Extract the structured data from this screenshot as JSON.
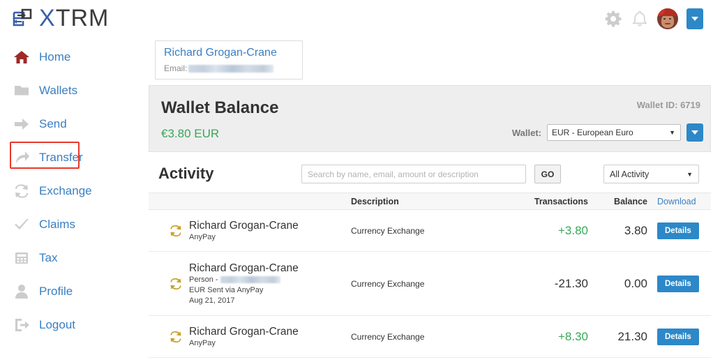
{
  "brand": {
    "name_x": "X",
    "name_rest": "TRM",
    "logo_icon": "exchange-logo-icon"
  },
  "header": {
    "gear_icon": "gear-icon",
    "bell_icon": "bell-icon",
    "avatar_icon": "user-avatar",
    "caret_icon": "chevron-down-icon"
  },
  "sidebar": {
    "items": [
      {
        "label": "Home",
        "icon": "home-icon",
        "active": false
      },
      {
        "label": "Wallets",
        "icon": "folder-icon",
        "active": false
      },
      {
        "label": "Send",
        "icon": "arrow-right-icon",
        "active": false
      },
      {
        "label": "Transfer",
        "icon": "arrow-up-right-icon",
        "active": true
      },
      {
        "label": "Exchange",
        "icon": "exchange-arrows-icon",
        "active": false
      },
      {
        "label": "Claims",
        "icon": "check-icon",
        "active": false
      },
      {
        "label": "Tax",
        "icon": "calculator-icon",
        "active": false
      },
      {
        "label": "Profile",
        "icon": "person-icon",
        "active": false
      },
      {
        "label": "Logout",
        "icon": "logout-icon",
        "active": false
      }
    ]
  },
  "user_card": {
    "name": "Richard Grogan-Crane",
    "email_label": "Email:",
    "email_value": "",
    "email_redacted": true
  },
  "wallet": {
    "title": "Wallet Balance",
    "balance": "€3.80 EUR",
    "wallet_id": "Wallet ID: 6719",
    "select_label": "Wallet:",
    "selected_wallet": "EUR - European Euro",
    "caret_icon": "chevron-down-icon"
  },
  "activity": {
    "title": "Activity",
    "search_placeholder": "Search by name, email, amount or description",
    "search_value": "",
    "go_label": "GO",
    "filter_selected": "All Activity",
    "columns": {
      "who": "",
      "description": "Description",
      "transactions": "Transactions",
      "balance": "Balance",
      "download": "Download"
    },
    "rows": [
      {
        "icon": "exchange-arrows-icon",
        "name": "Richard Grogan-Crane",
        "sub1": "AnyPay",
        "sub2": "",
        "sub3": "",
        "person_label": "",
        "description": "Currency Exchange",
        "transaction": "+3.80",
        "transaction_sign": "positive",
        "balance": "3.80",
        "action": "Details"
      },
      {
        "icon": "exchange-arrows-icon",
        "name": "Richard Grogan-Crane",
        "person_label": "Person -",
        "sub1": "",
        "sub2": "EUR Sent via AnyPay",
        "sub3": "Aug 21, 2017",
        "description": "Currency Exchange",
        "transaction": "-21.30",
        "transaction_sign": "negative",
        "balance": "0.00",
        "action": "Details"
      },
      {
        "icon": "exchange-arrows-icon",
        "name": "Richard Grogan-Crane",
        "sub1": "AnyPay",
        "sub2": "",
        "sub3": "",
        "person_label": "",
        "description": "Currency Exchange",
        "transaction": "+8.30",
        "transaction_sign": "positive",
        "balance": "21.30",
        "action": "Details"
      }
    ]
  },
  "colors": {
    "brand_blue": "#3a5fa8",
    "link_blue": "#3a7fc1",
    "button_blue": "#2d88c8",
    "positive_green": "#3aa757",
    "highlight_red": "#e8392a",
    "icon_gray": "#cccccc",
    "home_red": "#9e2a28",
    "exchange_gold": "#c9a227"
  }
}
